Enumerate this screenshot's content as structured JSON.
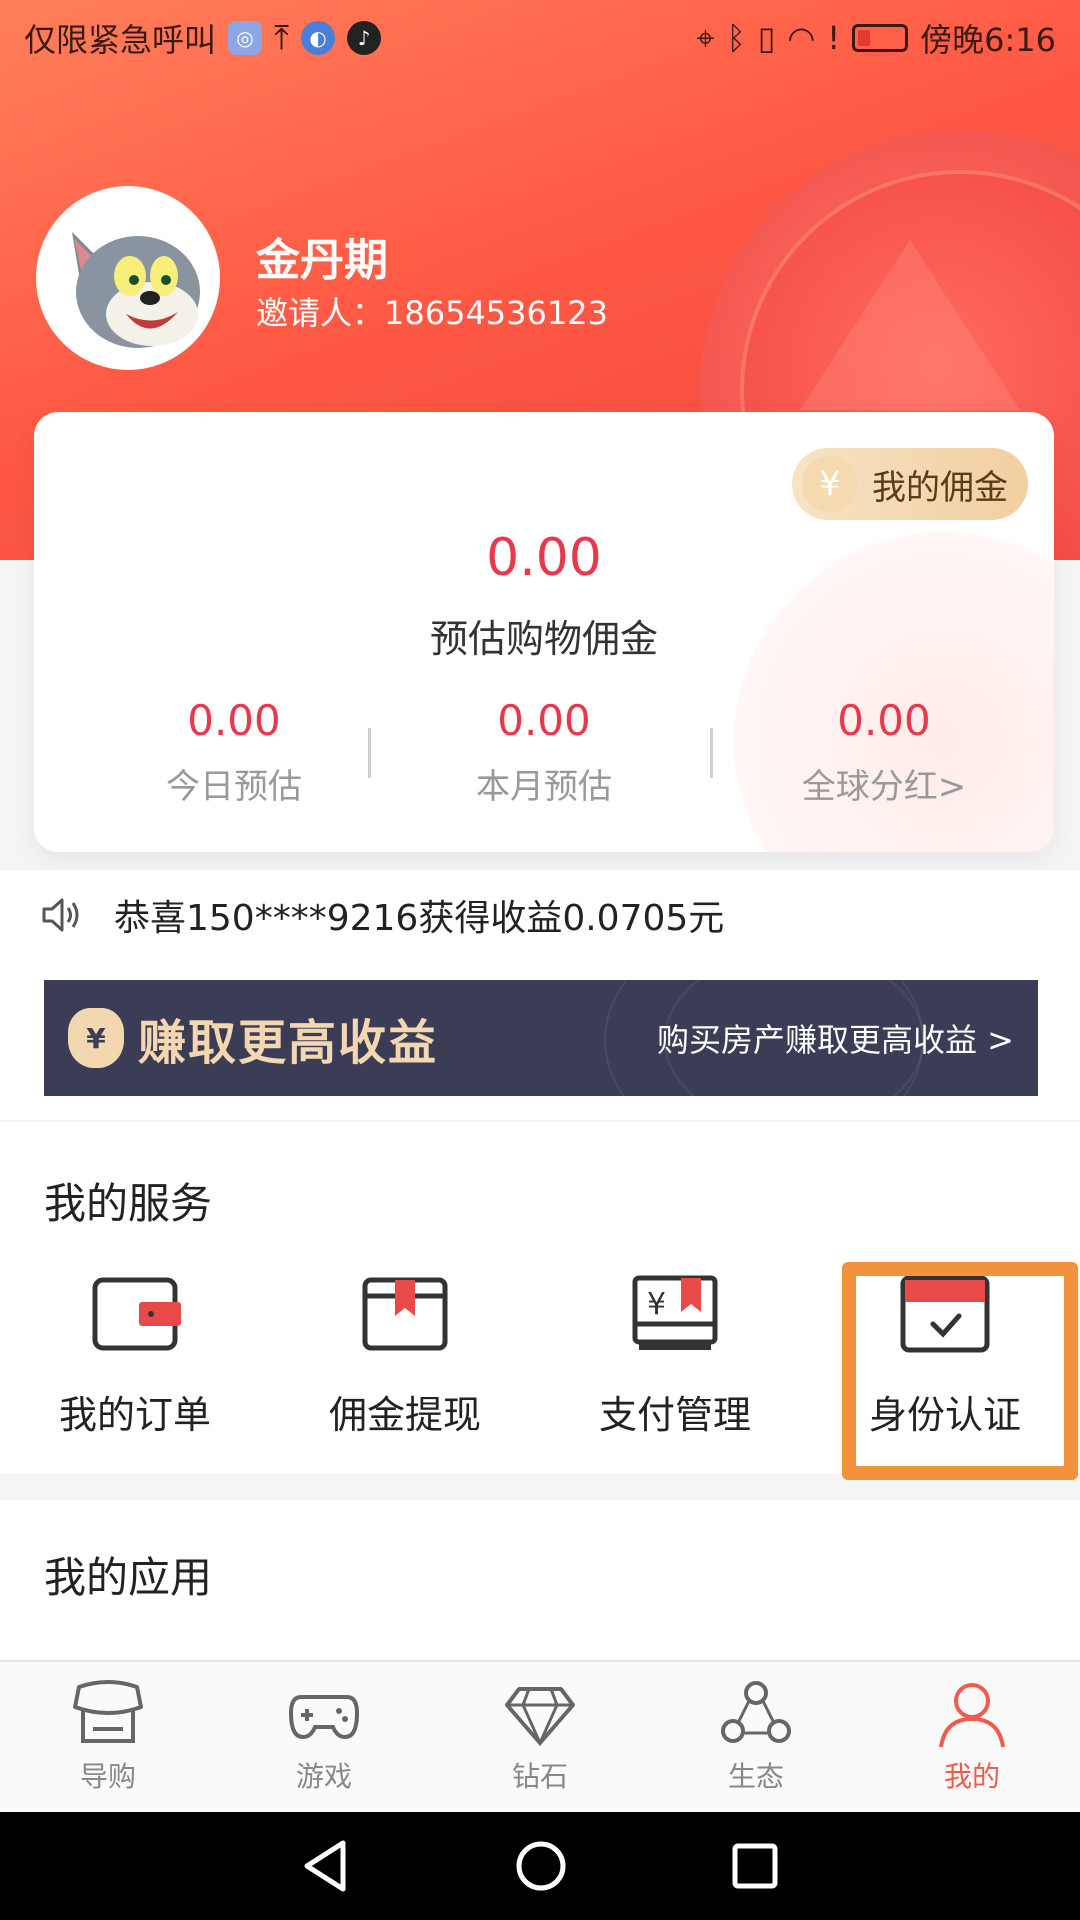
{
  "status_bar": {
    "left_text": "仅限紧急呼叫",
    "time": "傍晚6:16"
  },
  "profile": {
    "name": "金丹期",
    "inviter": "邀请人：18654536123"
  },
  "commission_card": {
    "button_label": "我的佣金",
    "estimated_amount": "0.00",
    "estimated_label": "预估购物佣金",
    "stats": [
      {
        "amount": "0.00",
        "label": "今日预估"
      },
      {
        "amount": "0.00",
        "label": "本月预估"
      },
      {
        "amount": "0.00",
        "label": "全球分红>"
      }
    ]
  },
  "notice": {
    "text": "恭喜150****9216获得收益0.0705元"
  },
  "banner": {
    "title": "赚取更高收益",
    "link": "购买房产赚取更高收益 >"
  },
  "services": {
    "title": "我的服务",
    "items": [
      {
        "label": "我的订单",
        "icon": "wallet-icon"
      },
      {
        "label": "佣金提现",
        "icon": "withdraw-box-icon"
      },
      {
        "label": "支付管理",
        "icon": "payment-yen-icon"
      },
      {
        "label": "身份认证",
        "icon": "calendar-check-icon"
      }
    ]
  },
  "apps": {
    "title": "我的应用"
  },
  "bottom_nav": [
    {
      "label": "导购",
      "icon": "shop-icon"
    },
    {
      "label": "游戏",
      "icon": "gamepad-icon"
    },
    {
      "label": "钻石",
      "icon": "diamond-icon"
    },
    {
      "label": "生态",
      "icon": "network-icon"
    },
    {
      "label": "我的",
      "icon": "person-icon",
      "active": true
    }
  ],
  "colors": {
    "accent_red": "#e8384b",
    "highlight_orange": "#f2923c",
    "banner_bg": "#3a3d55",
    "nav_active": "#ef5b4c"
  }
}
